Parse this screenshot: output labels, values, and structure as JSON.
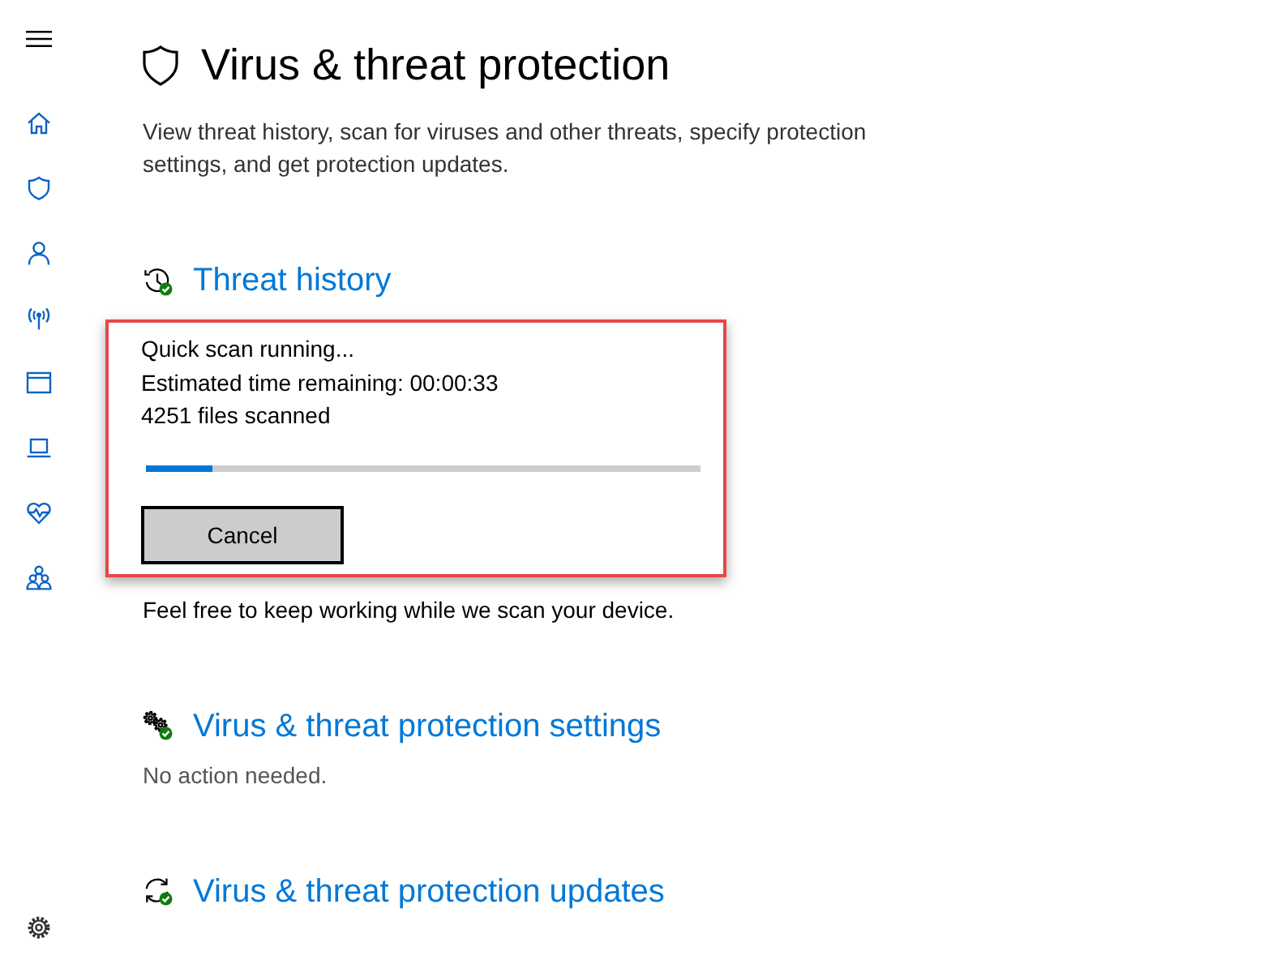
{
  "page": {
    "title": "Virus & threat protection",
    "description": "View threat history, scan for viruses and other threats, specify protection settings, and get protection updates."
  },
  "sections": [
    {
      "heading": "Threat history",
      "scan": {
        "highlighted": true,
        "status": "Quick scan running...",
        "time": "Estimated time remaining: 00:00:33",
        "files": "4251 files scanned",
        "level": 0.12,
        "button": "Cancel"
      },
      "note": "Feel free to keep working while we scan your device."
    },
    {
      "heading": "Virus & threat protection settings",
      "note": "No action needed."
    },
    {
      "heading": "Virus & threat protection updates"
    }
  ]
}
